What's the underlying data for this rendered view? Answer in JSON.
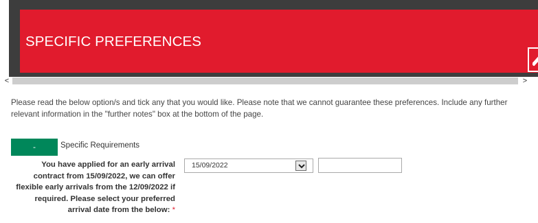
{
  "header": {
    "title": "SPECIFIC PREFERENCES",
    "background": "#e11b2d",
    "frame": "#3d3d3d",
    "collapse_icon": "chevron-up-icon"
  },
  "scrollbar": {
    "left_arrow": "<",
    "right_arrow": ">"
  },
  "intro_text": "Please read the below option/s and tick any that you would like. Please note that we cannot guarantee these preferences. Include any further relevant information in the \"further notes\" box at the bottom of the page.",
  "section": {
    "toggle_label": "-",
    "toggle_color": "#00875a",
    "label": "Specific Requirements"
  },
  "question": {
    "text": "You have applied for an early arrival contract from 15/09/2022, we can offer flexible early arrivals from the 12/09/2022 if required. Please select your preferred arrival date from the below:",
    "required_marker": "*",
    "selected_date": "15/09/2022",
    "dropdown_icon": "chevron-down-icon",
    "extra_value": ""
  }
}
